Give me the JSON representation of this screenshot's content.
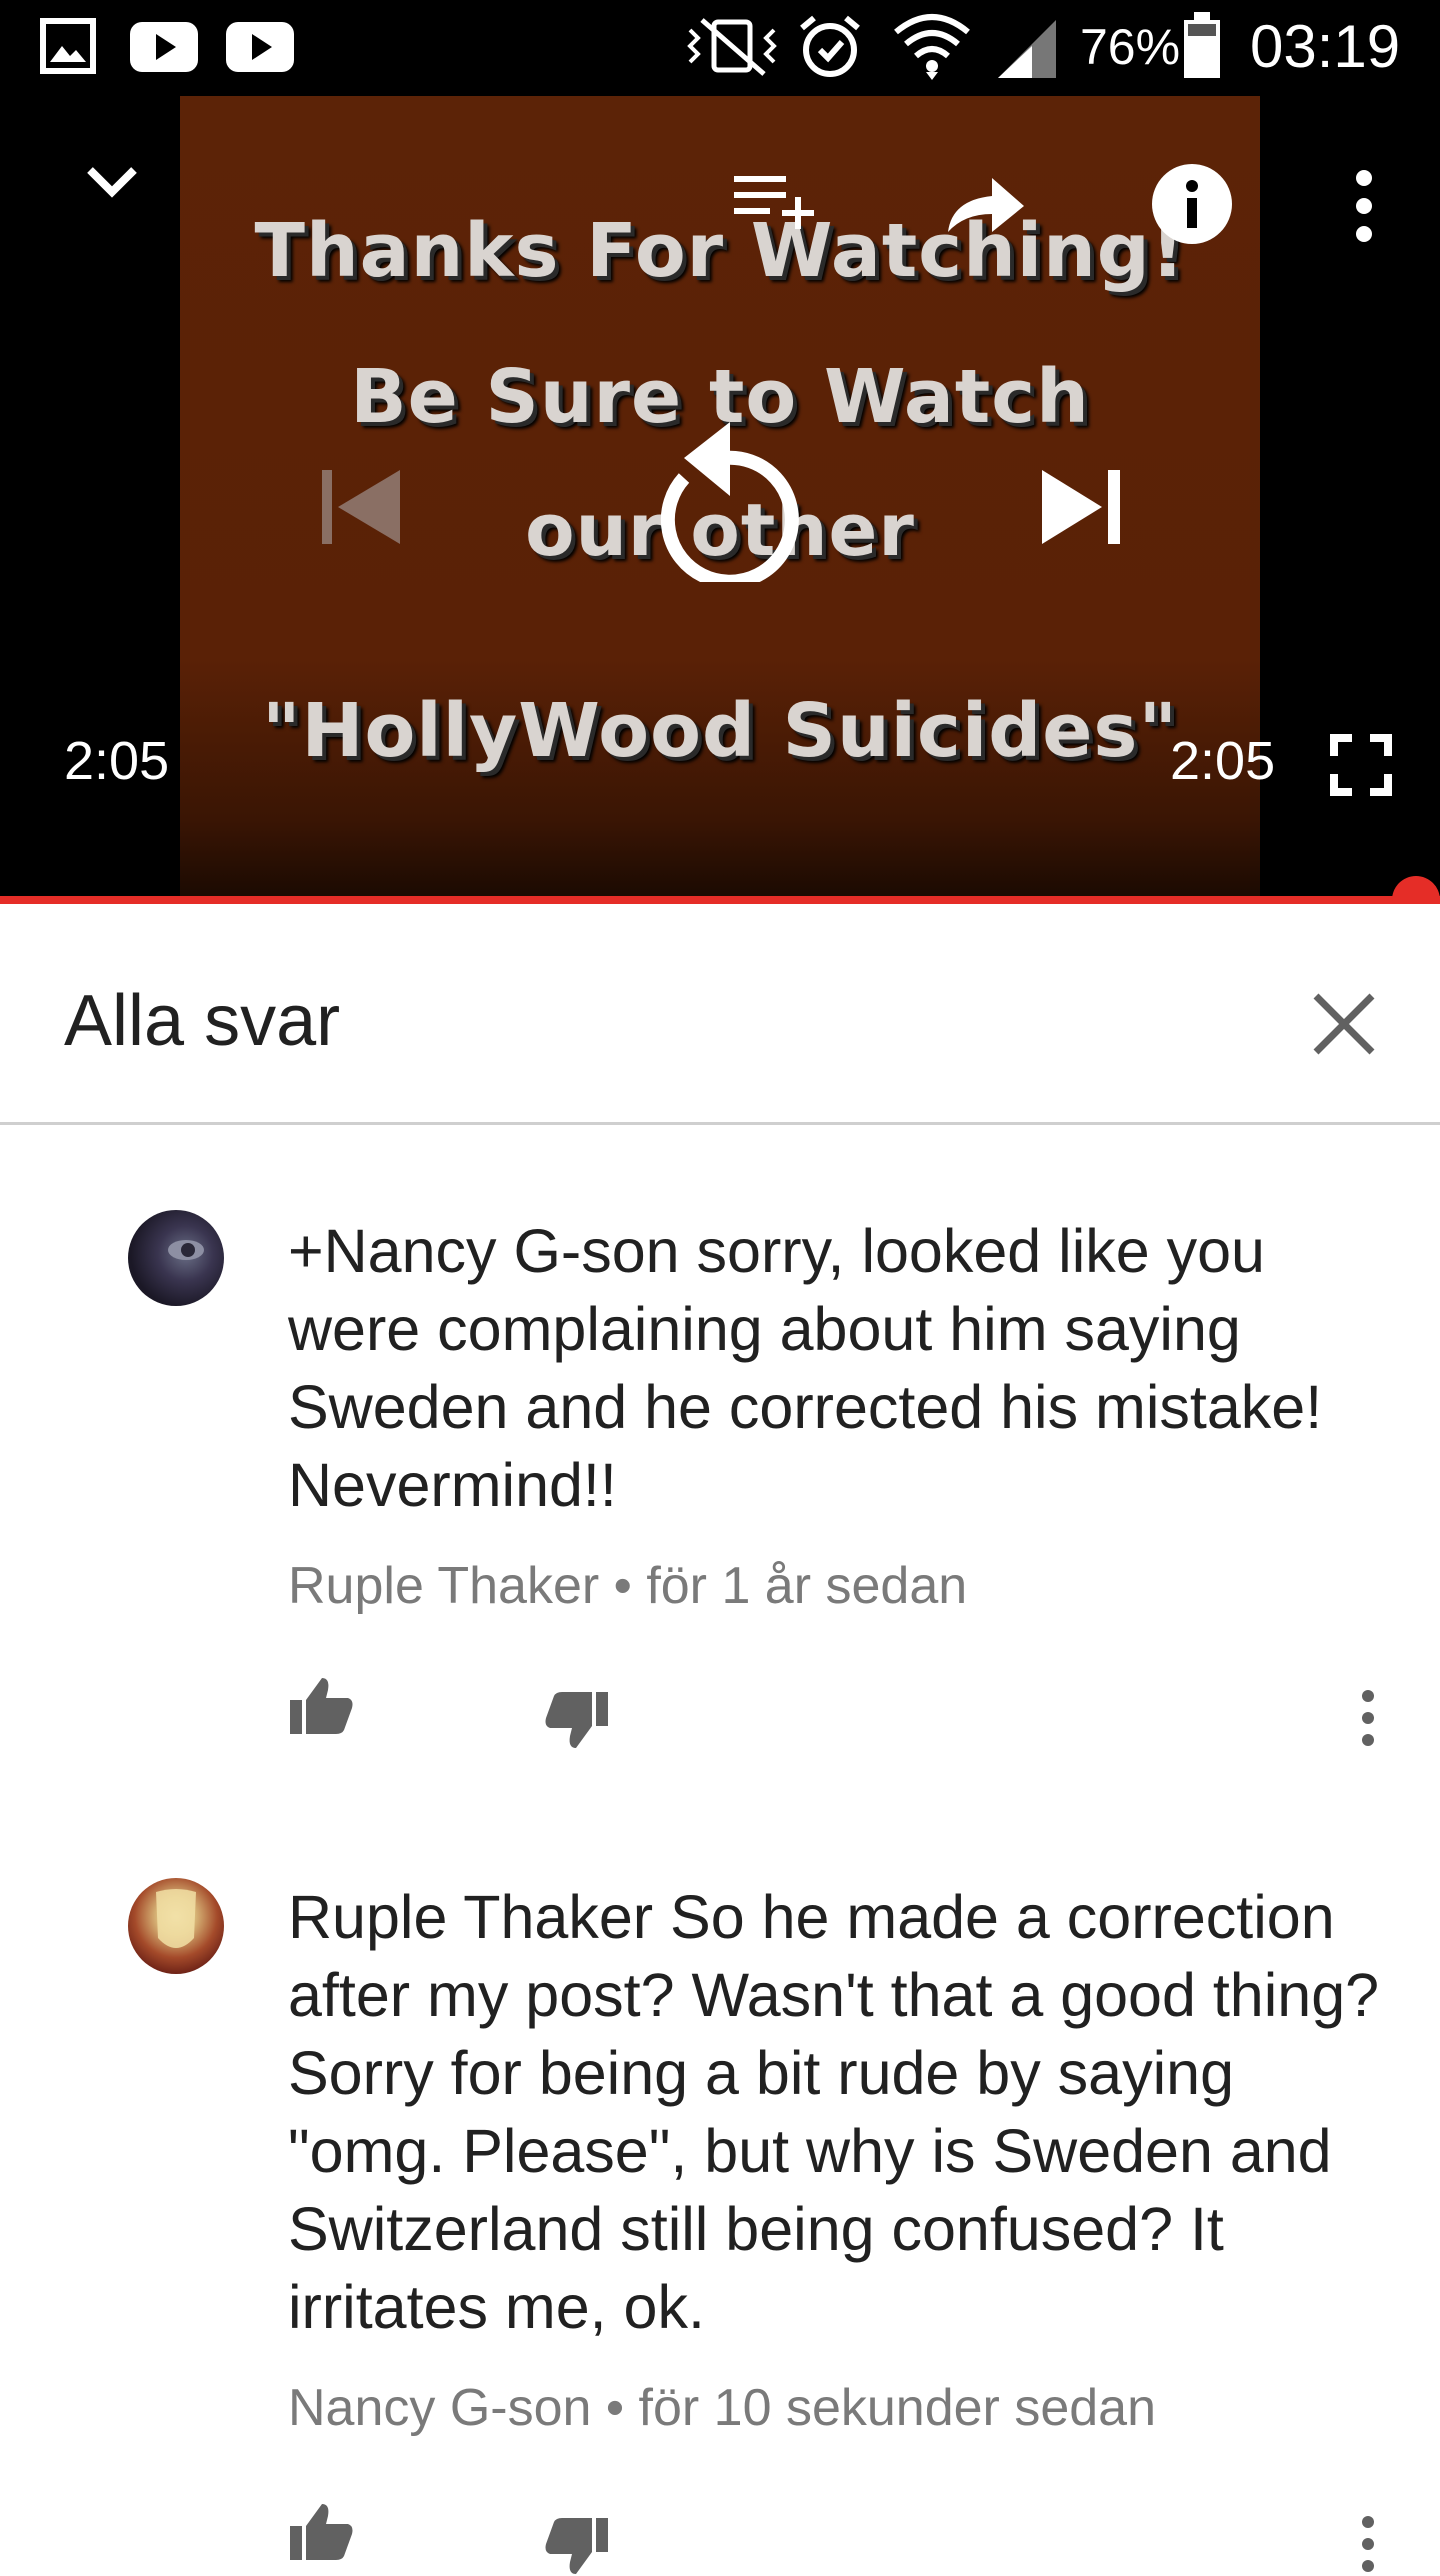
{
  "status_bar": {
    "battery": "76%",
    "time": "03:19",
    "left_icons": [
      "gallery-icon",
      "youtube-icon",
      "youtube-icon"
    ],
    "right_icons": [
      "vibrate-icon",
      "alarm-icon",
      "wifi-icon",
      "signal-icon",
      "battery-icon"
    ]
  },
  "player": {
    "video_lines": [
      "Thanks For Watching!",
      "Be Sure to Watch",
      "our other",
      "\"HollyWood Suicides\""
    ],
    "current_time": "2:05",
    "duration": "2:05",
    "progress": 1.0,
    "accent_color": "#e52d27",
    "controls": [
      "minimize-icon",
      "add-to-playlist-icon",
      "share-icon",
      "info-icon",
      "more-vert-icon",
      "previous-icon",
      "replay-icon",
      "next-icon",
      "fullscreen-icon"
    ]
  },
  "replies": {
    "title": "Alla svar",
    "comments": [
      {
        "text": "+Nancy G-son sorry, looked like you were complaining about him saying Sweden and he corrected his mistake! Nevermind!!",
        "meta": "Ruple Thaker • för 1 år sedan"
      },
      {
        "text": "Ruple Thaker So he made a correction after my post? Wasn't that a good thing? Sorry for being a bit rude by saying \"omg. Please\", but why is Sweden and Switzerland still being confused? It irritates me, ok.",
        "meta": "Nancy G-son • för 10 sekunder sedan"
      }
    ]
  }
}
